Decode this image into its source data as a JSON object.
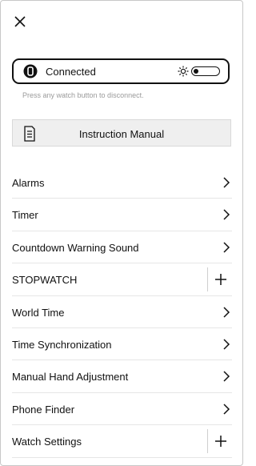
{
  "status": {
    "connection_label": "Connected",
    "battery_level": 0.2,
    "hint": "Press any watch button to disconnect."
  },
  "manual": {
    "label": "Instruction Manual"
  },
  "menu": [
    {
      "label": "Alarms",
      "action": "chevron"
    },
    {
      "label": "Timer",
      "action": "chevron"
    },
    {
      "label": "Countdown Warning Sound",
      "action": "chevron"
    },
    {
      "label": "STOPWATCH",
      "action": "plus"
    },
    {
      "label": "World Time",
      "action": "chevron"
    },
    {
      "label": "Time Synchronization",
      "action": "chevron"
    },
    {
      "label": "Manual Hand Adjustment",
      "action": "chevron"
    },
    {
      "label": "Phone Finder",
      "action": "chevron"
    },
    {
      "label": "Watch Settings",
      "action": "plus"
    }
  ]
}
